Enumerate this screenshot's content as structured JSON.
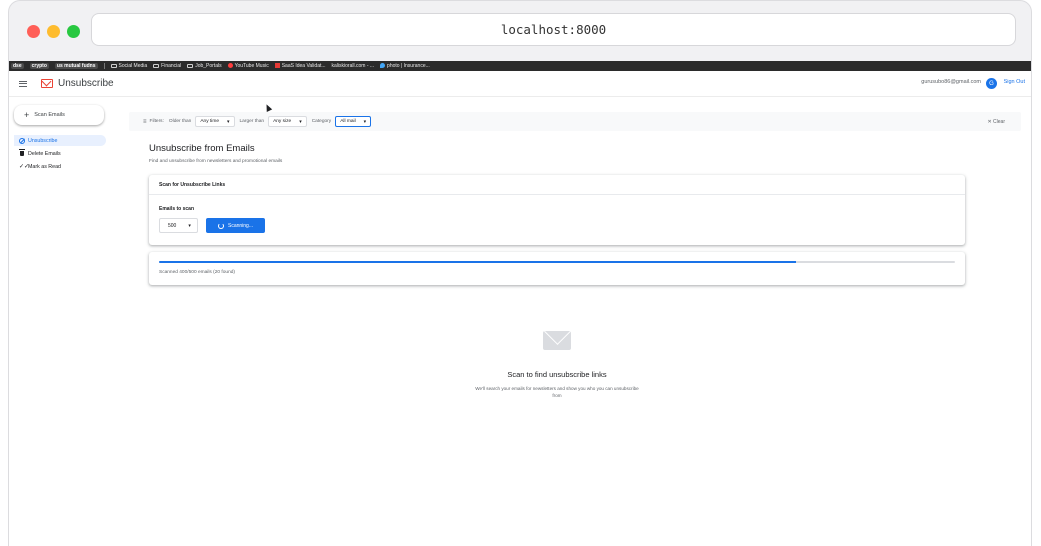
{
  "browser": {
    "url": "localhost:8000"
  },
  "bookmarks": {
    "items": [
      {
        "label": "dse",
        "kind": "pill"
      },
      {
        "label": "crypto",
        "kind": "pill"
      },
      {
        "label": "us mutual fudns",
        "kind": "pill"
      },
      {
        "label": "Social Media",
        "kind": "folder"
      },
      {
        "label": "Financial",
        "kind": "folder"
      },
      {
        "label": "Job_Portals",
        "kind": "folder"
      },
      {
        "label": "YouTube Music",
        "kind": "youtube"
      },
      {
        "label": "SaaS Idea Validat...",
        "kind": "pdf"
      },
      {
        "label": "kaliskiorall.com - ...",
        "kind": "site"
      },
      {
        "label": "photo | Insurance...",
        "kind": "drop"
      }
    ]
  },
  "app": {
    "title": "Unsubscribe",
    "user_email": "gurusubo86@gmail.com",
    "avatar_letter": "G",
    "signout_label": "Sign Out",
    "brand_color": "#ea4335",
    "accent_color": "#1a73e8"
  },
  "sidebar": {
    "scan_button": "Scan Emails",
    "items": [
      {
        "label": "Unsubscribe",
        "icon": "unsubscribe-icon",
        "active": true
      },
      {
        "label": "Delete Emails",
        "icon": "trash-icon",
        "active": false
      },
      {
        "label": "Mark as Read",
        "icon": "double-check-icon",
        "active": false
      }
    ]
  },
  "filters": {
    "label": "Filters:",
    "older_than_label": "Older than",
    "older_than_value": "Any time",
    "larger_than_label": "Larger than",
    "larger_than_value": "Any size",
    "category_label": "Category",
    "category_value": "All mail",
    "clear_label": "Clear"
  },
  "main": {
    "title": "Unsubscribe from Emails",
    "subtitle": "Find and unsubscribe from newsletters and promotional emails",
    "scan_card": {
      "heading": "Scan for Unsubscribe Links",
      "emails_label": "Emails to scan",
      "count_value": "500",
      "button_label": "Scanning..."
    },
    "progress": {
      "fraction": 0.8,
      "text": "Scanned 400/500 emails (20 found)"
    },
    "empty_state": {
      "icon": "mail-icon",
      "title": "Scan to find unsubscribe links",
      "subtitle": "We'll search your emails for newsletters and show you who you can unsubscribe from"
    }
  }
}
